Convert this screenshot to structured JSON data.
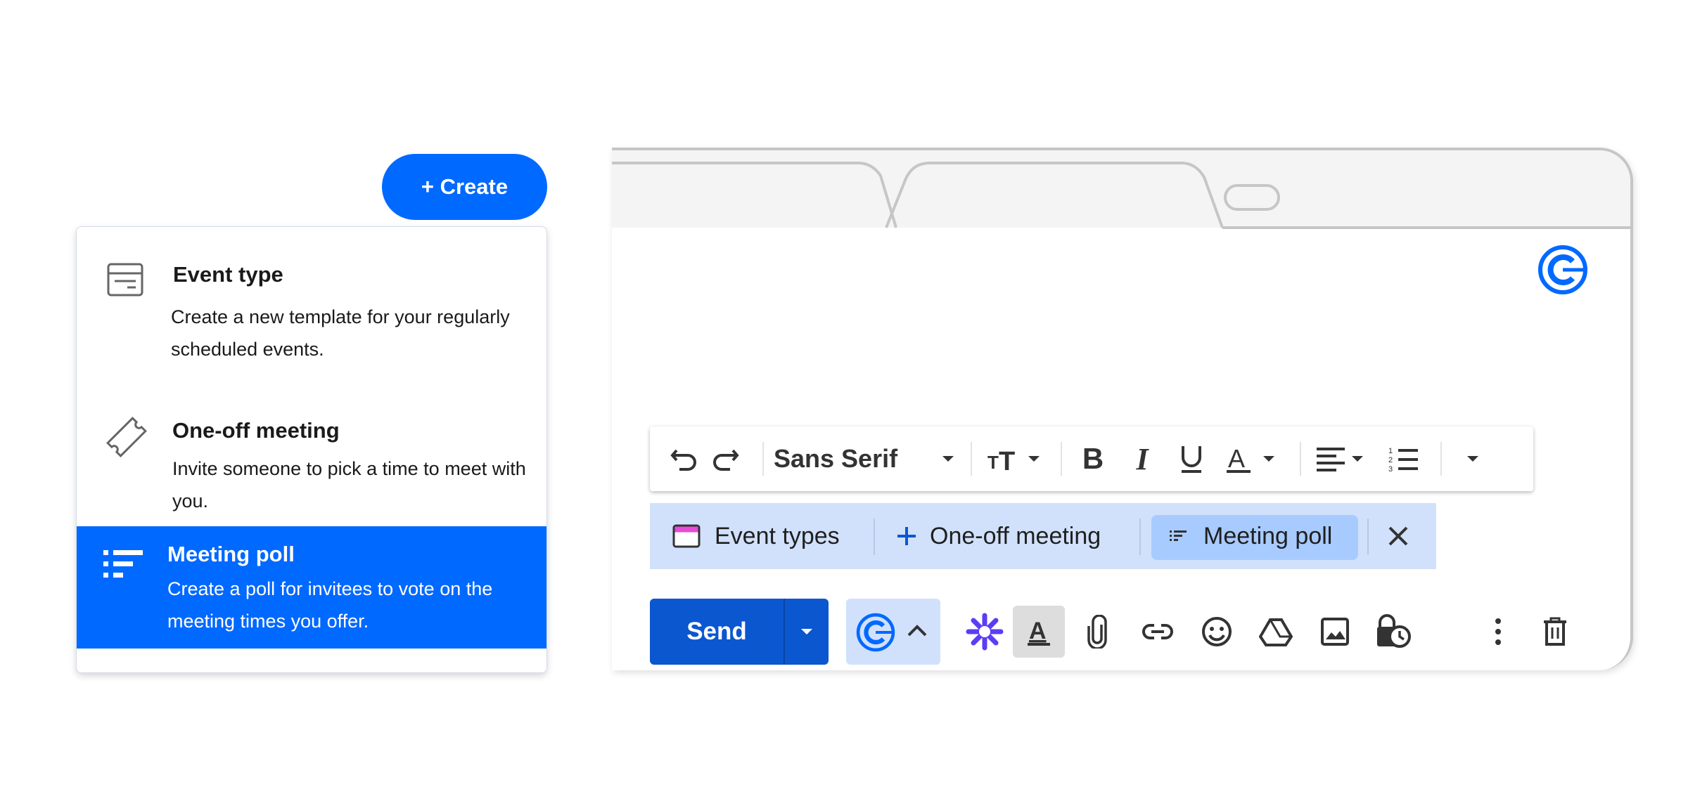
{
  "create_button": {
    "label": "+ Create"
  },
  "menu": {
    "items": [
      {
        "title": "Event type",
        "desc": "Create a new template for your regularly scheduled events.",
        "icon": "event-type-icon"
      },
      {
        "title": "One-off meeting",
        "desc": "Invite someone to pick a time to meet with you.",
        "icon": "ticket-icon"
      },
      {
        "title": "Meeting poll",
        "desc": "Create a poll for invitees to vote on the meeting times you offer.",
        "icon": "poll-list-icon",
        "selected": true
      }
    ]
  },
  "format_toolbar": {
    "font": "Sans Serif",
    "tools": [
      "undo-icon",
      "redo-icon",
      "font-size-icon",
      "bold-icon",
      "italic-icon",
      "underline-icon",
      "text-color-icon",
      "align-icon",
      "numbered-list-icon",
      "more-formatting-icon"
    ]
  },
  "calendly_strip": {
    "event_types": "Event types",
    "one_off": "One-off meeting",
    "meeting_poll": "Meeting poll"
  },
  "compose": {
    "send_label": "Send",
    "tools": [
      "sparkle-icon",
      "formatting-icon",
      "attach-icon",
      "link-icon",
      "emoji-icon",
      "drive-icon",
      "image-icon",
      "lock-clock-icon",
      "more-options-icon",
      "trash-icon"
    ]
  },
  "colors": {
    "calendly_blue": "#0069ff",
    "gmail_send_blue": "#0b57d0",
    "strip_bg": "#d1e1fb",
    "chip_bg": "#a8cbff"
  }
}
